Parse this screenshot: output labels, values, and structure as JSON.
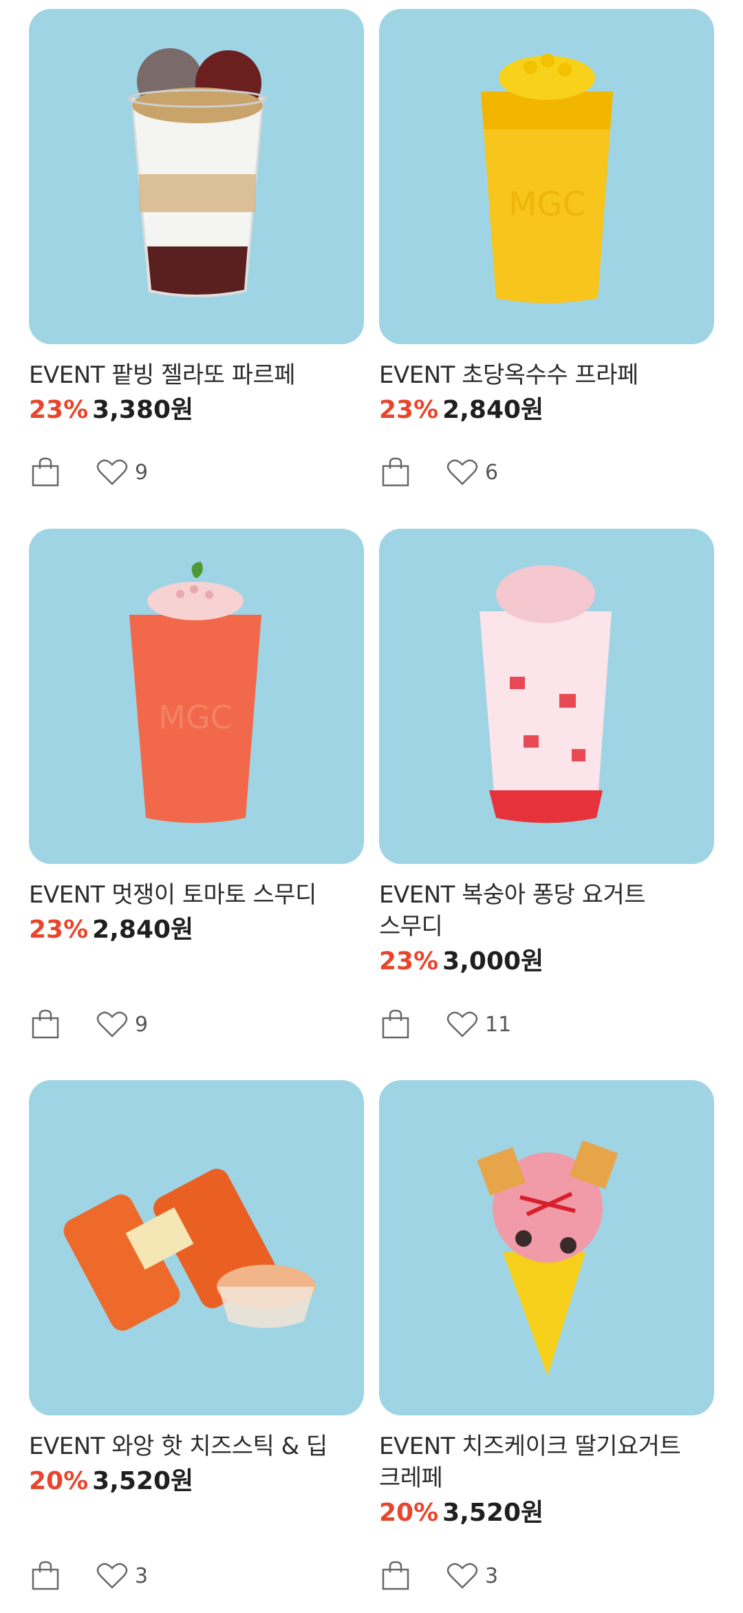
{
  "products": [
    {
      "name": "EVENT 팥빙 젤라또 파르페",
      "discount": "23%",
      "price": "3,380원",
      "likes": "9",
      "image": "red-bean-gelato-parfait"
    },
    {
      "name": "EVENT 초당옥수수 프라페",
      "discount": "23%",
      "price": "2,840원",
      "likes": "6",
      "image": "sweet-corn-frappe"
    },
    {
      "name": "EVENT 멋쟁이 토마토 스무디",
      "discount": "23%",
      "price": "2,840원",
      "likes": "9",
      "image": "tomato-smoothie"
    },
    {
      "name": "EVENT 복숭아 퐁당 요거트 스무디",
      "discount": "23%",
      "price": "3,000원",
      "likes": "11",
      "image": "peach-yogurt-smoothie"
    },
    {
      "name": "EVENT 와앙 핫 치즈스틱 & 딥",
      "discount": "20%",
      "price": "3,520원",
      "likes": "3",
      "image": "cheese-stick-dip"
    },
    {
      "name": "EVENT 치즈케이크 딸기요거트 크레페",
      "discount": "20%",
      "price": "3,520원",
      "likes": "3",
      "image": "strawberry-yogurt-crepe"
    }
  ],
  "icons": {
    "cart": "shopping-bag-icon",
    "like": "heart-icon"
  },
  "colors": {
    "thumb_bg": "#9fd4e4",
    "discount": "#e8452c"
  }
}
